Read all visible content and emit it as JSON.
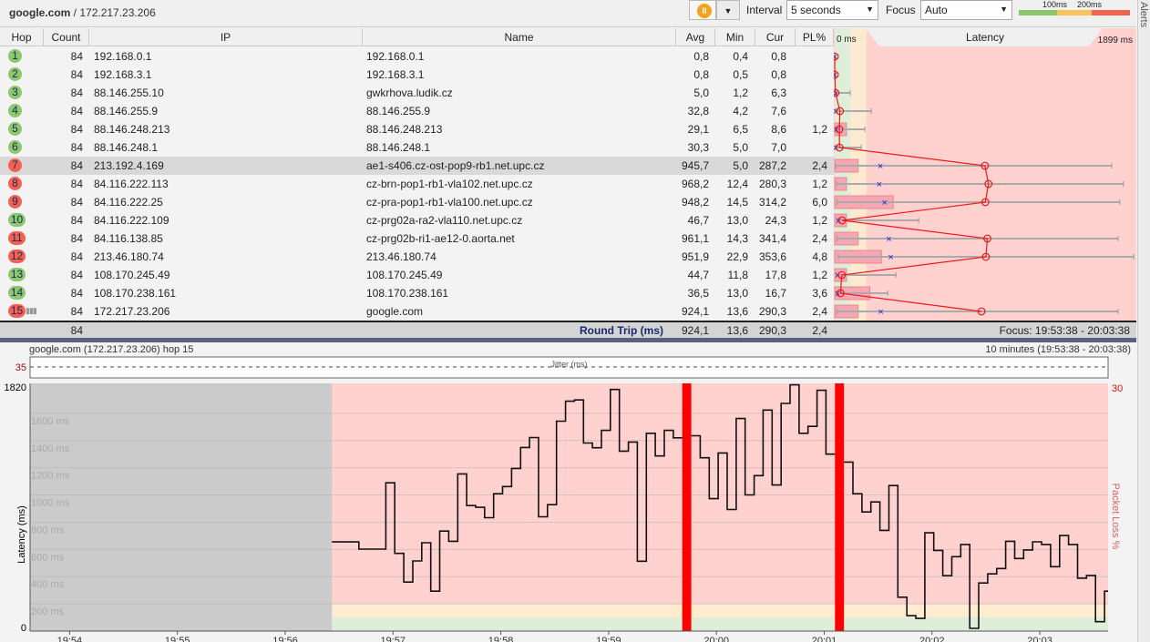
{
  "topbar": {
    "target_host": "google.com",
    "target_ip": " / 172.217.23.206",
    "pause_icon": "pause-icon",
    "interval_label": "Interval",
    "interval_value": "5 seconds",
    "focus_label": "Focus",
    "focus_value": "Auto",
    "scale_100": "100ms",
    "scale_200": "200ms",
    "alerts_label": "Alerts",
    "colors": {
      "good": "#8dc86a",
      "warn": "#fbc15a",
      "bad": "#f4624f"
    }
  },
  "table": {
    "headers": {
      "hop": "Hop",
      "count": "Count",
      "ip": "IP",
      "name": "Name",
      "avg": "Avg",
      "min": "Min",
      "cur": "Cur",
      "pl": "PL%",
      "latency": "Latency",
      "lat_min": "0 ms",
      "lat_max": "1899 ms"
    },
    "latency_scale_max_ms": 1899,
    "rows": [
      {
        "hop": "1",
        "count": "84",
        "ip": "192.168.0.1",
        "name": "192.168.0.1",
        "avg": "0,8",
        "min": "0,4",
        "cur": "0,8",
        "pl": "",
        "status": "good",
        "max_ms": 2
      },
      {
        "hop": "2",
        "count": "84",
        "ip": "192.168.3.1",
        "name": "192.168.3.1",
        "avg": "0,8",
        "min": "0,5",
        "cur": "0,8",
        "pl": "",
        "status": "good",
        "max_ms": 2
      },
      {
        "hop": "3",
        "count": "84",
        "ip": "88.146.255.10",
        "name": "gwkrhova.ludik.cz",
        "avg": "5,0",
        "min": "1,2",
        "cur": "6,3",
        "pl": "",
        "status": "good",
        "max_ms": 98
      },
      {
        "hop": "4",
        "count": "84",
        "ip": "88.146.255.9",
        "name": "88.146.255.9",
        "avg": "32,8",
        "min": "4,2",
        "cur": "7,6",
        "pl": "",
        "status": "good",
        "max_ms": 230
      },
      {
        "hop": "5",
        "count": "84",
        "ip": "88.146.248.213",
        "name": "88.146.248.213",
        "avg": "29,1",
        "min": "6,5",
        "cur": "8,6",
        "pl": "1,2",
        "status": "good",
        "max_ms": 190
      },
      {
        "hop": "6",
        "count": "84",
        "ip": "88.146.248.1",
        "name": "88.146.248.1",
        "avg": "30,3",
        "min": "5,0",
        "cur": "7,0",
        "pl": "",
        "status": "good",
        "max_ms": 167
      },
      {
        "hop": "7",
        "count": "84",
        "ip": "213.192.4.169",
        "name": "ae1-s406.cz-ost-pop9-rb1.net.upc.cz",
        "avg": "945,7",
        "min": "5,0",
        "cur": "287,2",
        "pl": "2,4",
        "status": "bad",
        "max_ms": 1744,
        "selected": true
      },
      {
        "hop": "8",
        "count": "84",
        "ip": "84.116.222.113",
        "name": "cz-brn-pop1-rb1-vla102.net.upc.cz",
        "avg": "968,2",
        "min": "12,4",
        "cur": "280,3",
        "pl": "1,2",
        "status": "bad",
        "max_ms": 1818
      },
      {
        "hop": "9",
        "count": "84",
        "ip": "84.116.222.25",
        "name": "cz-pra-pop1-rb1-vla100.net.upc.cz",
        "avg": "948,2",
        "min": "14,5",
        "cur": "314,2",
        "pl": "6,0",
        "status": "bad",
        "max_ms": 1795
      },
      {
        "hop": "10",
        "count": "84",
        "ip": "84.116.222.109",
        "name": "cz-prg02a-ra2-vla110.net.upc.cz",
        "avg": "46,7",
        "min": "13,0",
        "cur": "24,3",
        "pl": "1,2",
        "status": "good",
        "max_ms": 529
      },
      {
        "hop": "11",
        "count": "84",
        "ip": "84.116.138.85",
        "name": "cz-prg02b-ri1-ae12-0.aorta.net",
        "avg": "961,1",
        "min": "14,3",
        "cur": "341,4",
        "pl": "2,4",
        "status": "bad",
        "max_ms": 1784
      },
      {
        "hop": "12",
        "count": "84",
        "ip": "213.46.180.74",
        "name": "213.46.180.74",
        "avg": "951,9",
        "min": "22,9",
        "cur": "353,6",
        "pl": "4,8",
        "status": "bad",
        "max_ms": 1882
      },
      {
        "hop": "13",
        "count": "84",
        "ip": "108.170.245.49",
        "name": "108.170.245.49",
        "avg": "44,7",
        "min": "11,8",
        "cur": "17,8",
        "pl": "1,2",
        "status": "good",
        "max_ms": 386
      },
      {
        "hop": "14",
        "count": "84",
        "ip": "108.170.238.161",
        "name": "108.170.238.161",
        "avg": "36,5",
        "min": "13,0",
        "cur": "16,7",
        "pl": "3,6",
        "status": "good",
        "max_ms": 334
      },
      {
        "hop": "15",
        "count": "84",
        "ip": "172.217.23.206",
        "name": "google.com",
        "avg": "924,1",
        "min": "13,6",
        "cur": "290,3",
        "pl": "2,4",
        "status": "bad",
        "max_ms": 1784
      }
    ],
    "footer": {
      "count": "84",
      "label": "Round Trip (ms)",
      "avg": "924,1",
      "min": "13,6",
      "cur": "290,3",
      "pl": "2,4",
      "focus": "Focus: 19:53:38 - 20:03:38"
    }
  },
  "bottom": {
    "title": "google.com (172.217.23.206) hop 15",
    "range": "10 minutes (19:53:38 - 20:03:38)"
  },
  "chart_data": {
    "type": "line",
    "title": "google.com (172.217.23.206) hop 15",
    "ylabel": "Latency (ms)",
    "y2label": "Packet Loss %",
    "ylim": [
      0,
      1820
    ],
    "y_top_label": "1820",
    "y_bottom_label": "0",
    "y2_top_label": "30",
    "jitter_label": "Jitter (ms)",
    "jitter_max_label": "35",
    "gridlines": [
      "200 ms",
      "400 ms",
      "600 ms",
      "800 ms",
      "1000 ms",
      "1200 ms",
      "1400 ms",
      "1600 ms"
    ],
    "grid_values": [
      200,
      400,
      600,
      800,
      1000,
      1200,
      1400,
      1600
    ],
    "x_start": "19:53:38",
    "x_span_s": 600,
    "x_ticks": [
      "19:54",
      "19:55",
      "19:56",
      "19:57",
      "19:58",
      "19:59",
      "20:00",
      "20:01",
      "20:02",
      "20:03"
    ],
    "first_sample_offset_s": 168,
    "interval_s": 5,
    "thresholds_ms": [
      100,
      200
    ],
    "values": [
      655,
      655,
      655,
      602,
      602,
      602,
      1089,
      571,
      360,
      515,
      649,
      293,
      735,
      660,
      1155,
      922,
      909,
      833,
      1009,
      1062,
      1195,
      1349,
      1422,
      840,
      929,
      1542,
      1689,
      1698,
      1382,
      1347,
      1475,
      1775,
      1322,
      1389,
      513,
      1453,
      1287,
      1475,
      1420,
      null,
      1435,
      1273,
      973,
      1309,
      893,
      1562,
      1000,
      1142,
      1624,
      1073,
      1673,
      1809,
      1453,
      1504,
      1769,
      1300,
      null,
      1242,
      1009,
      875,
      949,
      740,
      1069,
      249,
      113,
      93,
      722,
      593,
      407,
      547,
      636,
      20,
      353,
      420,
      460,
      660,
      533,
      596,
      656,
      636,
      473,
      702,
      636,
      389,
      409,
      69,
      293
    ]
  }
}
